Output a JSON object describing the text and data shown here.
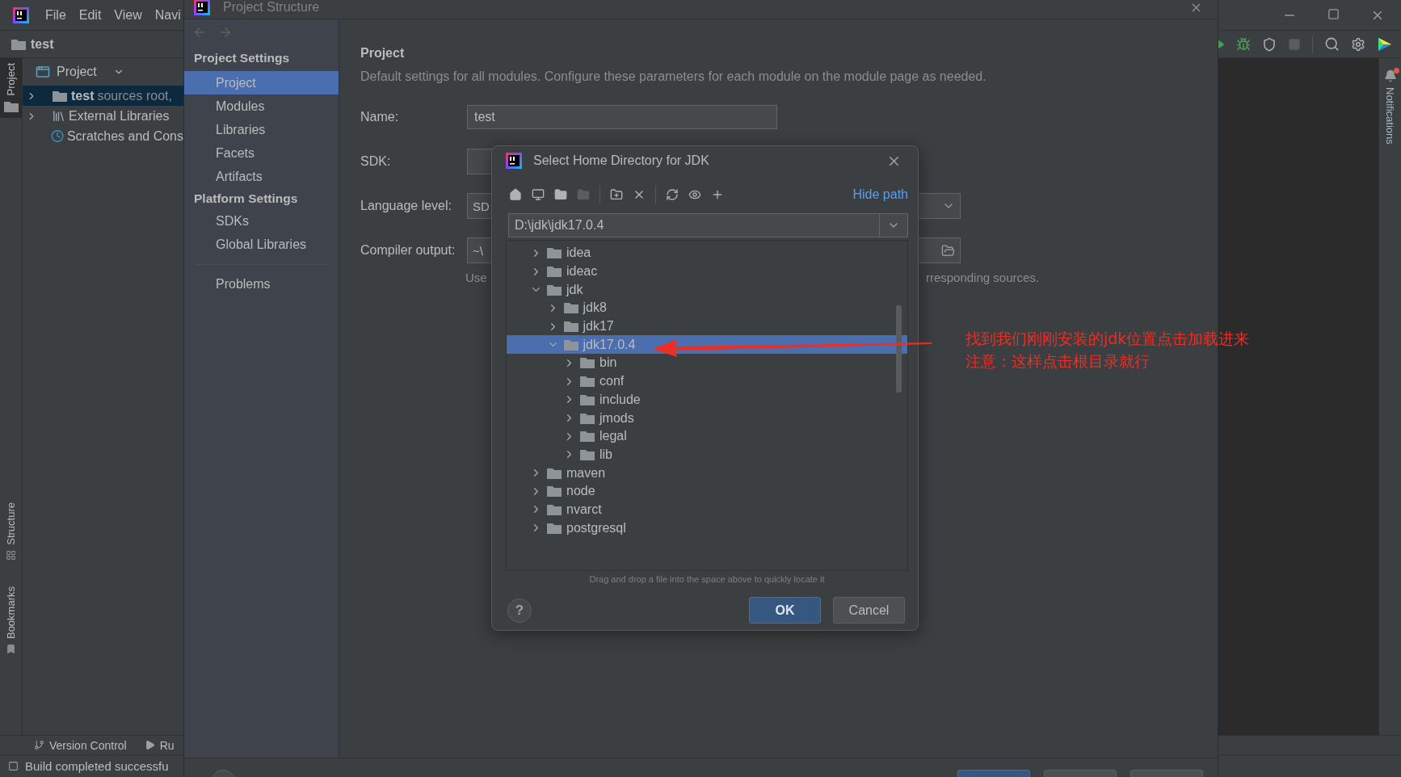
{
  "ide": {
    "menu": [
      {
        "label": "File"
      },
      {
        "label": "Edit"
      },
      {
        "label": "View"
      },
      {
        "label": "Navi"
      }
    ],
    "project_name": "test",
    "left_tool_tabs": [
      {
        "label": "Project",
        "kind": "project",
        "selected": true
      },
      {
        "label": "Structure",
        "kind": "structure",
        "selected": false
      },
      {
        "label": "Bookmarks",
        "kind": "bookmarks",
        "selected": false
      }
    ],
    "project_panel": {
      "title": "Project",
      "tree": [
        {
          "name": "test",
          "note": "sources root,",
          "kind": "module",
          "expanded": false,
          "selected": true
        },
        {
          "name": "External Libraries",
          "kind": "libraries",
          "expanded": false,
          "selected": false
        },
        {
          "name": "Scratches and Cons",
          "kind": "scratches",
          "selected": false
        }
      ]
    },
    "right_tool_tabs": [
      {
        "label": "Notifications",
        "badge": true
      }
    ],
    "bottom_tool_tabs": [
      {
        "label": "Version Control",
        "kind": "vcs"
      },
      {
        "label": "Ru",
        "kind": "run"
      }
    ],
    "status": "Build completed successfu"
  },
  "project_structure": {
    "title": "Project Structure",
    "sidebar": [
      {
        "kind": "header",
        "label": "Project Settings"
      },
      {
        "kind": "item",
        "label": "Project",
        "selected": true
      },
      {
        "kind": "item",
        "label": "Modules",
        "selected": false
      },
      {
        "kind": "item",
        "label": "Libraries",
        "selected": false
      },
      {
        "kind": "item",
        "label": "Facets",
        "selected": false
      },
      {
        "kind": "item",
        "label": "Artifacts",
        "selected": false
      },
      {
        "kind": "header",
        "label": "Platform Settings"
      },
      {
        "kind": "item",
        "label": "SDKs",
        "selected": false
      },
      {
        "kind": "item",
        "label": "Global Libraries",
        "selected": false
      },
      {
        "kind": "divider"
      },
      {
        "kind": "item",
        "label": "Problems",
        "selected": false
      }
    ],
    "page": {
      "heading": "Project",
      "description": "Default settings for all modules. Configure these parameters for each module on the module page as needed.",
      "fields": [
        {
          "label": "Name:",
          "kind": "text",
          "value": "test"
        },
        {
          "label": "SDK:",
          "kind": "sdk"
        },
        {
          "label": "Language level:",
          "kind": "dropdown",
          "value": "SD"
        },
        {
          "label": "Compiler output:",
          "kind": "folder",
          "value": "~\\"
        }
      ],
      "hint_start": "Use",
      "hint_end": "rresponding sources."
    }
  },
  "jdk_dialog": {
    "title": "Select Home Directory for JDK",
    "hide_path": "Hide path",
    "path": "D:\\jdk\\jdk17.0.4",
    "tree": [
      {
        "name": "idea",
        "expanded": false,
        "selected": false
      },
      {
        "name": "ideac",
        "expanded": false,
        "selected": false
      },
      {
        "name": "jdk",
        "expanded": true,
        "selected": false,
        "children": [
          {
            "name": "jdk8",
            "expanded": false,
            "selected": false
          },
          {
            "name": "jdk17",
            "expanded": false,
            "selected": false
          },
          {
            "name": "jdk17.0.4",
            "expanded": true,
            "selected": true,
            "children": [
              {
                "name": "bin",
                "expanded": false,
                "selected": false
              },
              {
                "name": "conf",
                "expanded": false,
                "selected": false
              },
              {
                "name": "include",
                "expanded": false,
                "selected": false
              },
              {
                "name": "jmods",
                "expanded": false,
                "selected": false
              },
              {
                "name": "legal",
                "expanded": false,
                "selected": false
              },
              {
                "name": "lib",
                "expanded": false,
                "selected": false
              }
            ]
          }
        ]
      },
      {
        "name": "maven",
        "expanded": false,
        "selected": false
      },
      {
        "name": "node",
        "expanded": false,
        "selected": false
      },
      {
        "name": "nvarct",
        "expanded": false,
        "selected": false
      },
      {
        "name": "postgresql",
        "expanded": false,
        "selected": false
      }
    ],
    "hint": "Drag and drop a file into the space above to quickly locate it",
    "help": "?",
    "buttons": [
      {
        "label": "OK",
        "kind": "primary"
      },
      {
        "label": "Cancel",
        "kind": "secondary"
      }
    ]
  },
  "annotation": {
    "lines": [
      "找到我们刚刚安装的jdk位置点击加载进来",
      "注意：这样点击根目录就行"
    ]
  }
}
